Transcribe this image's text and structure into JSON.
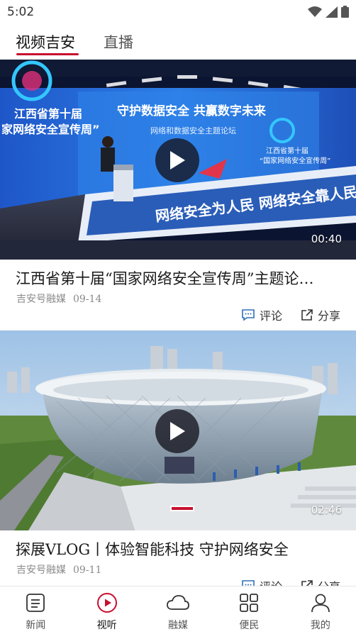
{
  "status_bar": {
    "time": "5:02"
  },
  "tabs": [
    {
      "label": "视频吉安",
      "active": true
    },
    {
      "label": "直播",
      "active": false
    }
  ],
  "feed": [
    {
      "title": "江西省第十届“国家网络安全宣传周”主题论…",
      "source": "吉安号融媒",
      "date": "09-14",
      "duration": "00:40",
      "comment_label": "评论",
      "share_label": "分享",
      "thumbnail_texts": {
        "banner_main": "守护数据安全  共赢数字未来",
        "banner_sub": "网络和数据安全主题论坛",
        "left_text_1": "江西省第十届",
        "left_text_2": "家网络安全宣传周”",
        "right_text_1": "江西省第十届",
        "right_text_2": "“国家网络安全宣传周”",
        "stage_front": "网络安全为人民  网络安全靠人民"
      }
    },
    {
      "title": "探展VLOG丨体验智能科技 守护网络安全",
      "source": "吉安号融媒",
      "date": "09-11",
      "duration": "02:46",
      "comment_label": "评论",
      "share_label": "分享"
    }
  ],
  "bottom_nav": [
    {
      "label": "新闻",
      "icon": "news-icon",
      "active": false
    },
    {
      "label": "视听",
      "icon": "play-circle-icon",
      "active": true
    },
    {
      "label": "融媒",
      "icon": "cloud-icon",
      "active": false
    },
    {
      "label": "便民",
      "icon": "grid-icon",
      "active": false
    },
    {
      "label": "我的",
      "icon": "user-icon",
      "active": false
    }
  ],
  "colors": {
    "accent": "#c8102e",
    "tab_underline": "#c8102e",
    "comment_icon": "#2f6fb6",
    "meta_text": "#8a8a8a"
  }
}
